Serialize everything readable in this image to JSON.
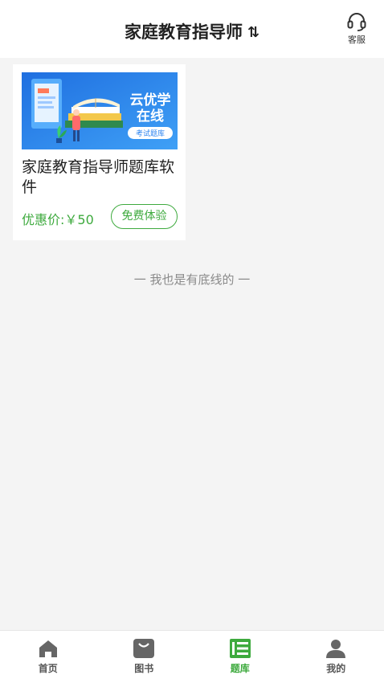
{
  "header": {
    "title": "家庭教育指导师",
    "switch_icon": "⇅",
    "service_label": "客服"
  },
  "product": {
    "title": "家庭教育指导师题库软件",
    "price": "优惠价:￥50",
    "trial_label": "免费体验",
    "banner": {
      "line1": "云优学",
      "line2": "在线",
      "badge": "考试题库"
    }
  },
  "bottom_line": "一 我也是有底线的 一",
  "tabbar": {
    "items": [
      {
        "label": "首页",
        "icon": "home-icon"
      },
      {
        "label": "图书",
        "icon": "book-bag-icon"
      },
      {
        "label": "题库",
        "icon": "question-bank-icon"
      },
      {
        "label": "我的",
        "icon": "user-icon"
      }
    ],
    "active_index": 2
  },
  "colors": {
    "accent": "#3eaa3e",
    "banner_blue": "#2f86f0",
    "background": "#f4f4f4"
  }
}
